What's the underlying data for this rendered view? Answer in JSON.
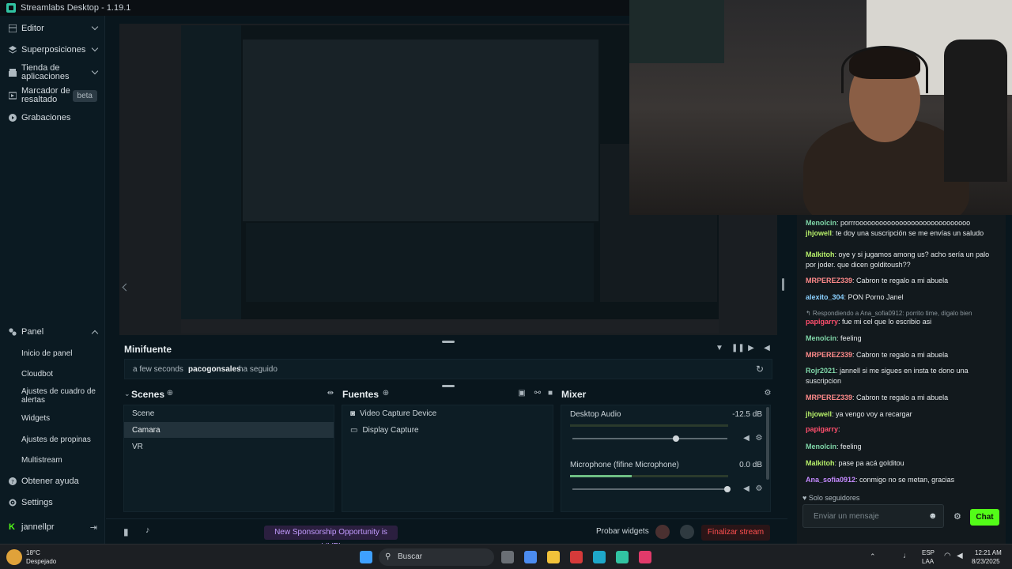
{
  "window": {
    "title": "Streamlabs Desktop - 1.19.1"
  },
  "sidebar": {
    "items": [
      {
        "label": "Editor"
      },
      {
        "label": "Superposiciones"
      },
      {
        "label": "Tienda de\naplicaciones"
      },
      {
        "label": "Marcador de\nresaltado",
        "badge": "beta"
      },
      {
        "label": "Grabaciones"
      }
    ],
    "panel": {
      "label": "Panel",
      "subitems": [
        "Inicio de panel",
        "Cloudbot",
        "Ajustes de cuadro de alertas",
        "Widgets",
        "Ajustes de propinas",
        "Multistream"
      ]
    },
    "help": "Obtener ayuda",
    "settings": "Settings",
    "user": "jannellpr"
  },
  "minifeed": {
    "title": "Minifuente",
    "event_time": "a few seconds",
    "event_user": "pacogonsales",
    "event_action": "ha seguido"
  },
  "scenes": {
    "title": "Scenes",
    "items": [
      "Scene",
      "Camara",
      "VR"
    ],
    "selected": "Camara"
  },
  "sources": {
    "title": "Fuentes",
    "items": [
      "Video Capture Device",
      "Display Capture"
    ]
  },
  "mixer": {
    "title": "Mixer",
    "channels": [
      {
        "name": "Desktop Audio",
        "db": "-12.5 dB",
        "level": 0.0,
        "volume": 0.67
      },
      {
        "name": "Microphone (fifine Microphone)",
        "db": "0.0 dB",
        "level": 0.39,
        "volume": 1.0
      }
    ]
  },
  "footer": {
    "sponsor": "New Sponsorship Opportunity is LIVE!",
    "widgets": "Probar widgets",
    "end_stream": "Finalizar stream"
  },
  "chat": {
    "messages": [
      {
        "user": "Menolcin",
        "color": "#7fd6a8",
        "text": "porrrooooooooooooooooooooooooooooo"
      },
      {
        "user": "jhjowell",
        "color": "#b7f06a",
        "text": "te doy una suscripción se me envías un saludo"
      },
      {
        "user": "Malkitoh",
        "color": "#b7f06a",
        "text": "oye y si jugamos among us? acho sería un palo por joder. que dicen golditoush??"
      },
      {
        "user": "MRPEREZ339",
        "color": "#ff8a8a",
        "text": "Cabron te regalo a mi abuela"
      },
      {
        "user": "alexito_304",
        "color": "#8ad0ff",
        "text": "PON Porno Janel"
      },
      {
        "reply": "Respondiendo a Ana_sofia0912: porrito time, dígalo bien"
      },
      {
        "user": "papigarry",
        "color": "#ff4f6d",
        "text": "fue mi cel que lo escribio asi"
      },
      {
        "user": "Menolcin",
        "color": "#7fd6a8",
        "text": "feeling"
      },
      {
        "user": "MRPEREZ339",
        "color": "#ff8a8a",
        "text": "Cabron te regalo a mi abuela"
      },
      {
        "user": "Rojr2021",
        "color": "#7fd6a8",
        "text": "jannell si me sigues en insta te dono una suscripcion"
      },
      {
        "user": "MRPEREZ339",
        "color": "#ff8a8a",
        "text": "Cabron te regalo a mi abuela"
      },
      {
        "user": "jhjowell",
        "color": "#b7f06a",
        "text": "ya vengo voy a recargar"
      },
      {
        "user": "papigarry",
        "color": "#ff4f6d",
        "text": ""
      },
      {
        "user": "Menolcin",
        "color": "#7fd6a8",
        "text": "feeling"
      },
      {
        "user": "Malkitoh",
        "color": "#b7f06a",
        "text": "pase pa acá golditou"
      },
      {
        "user": "Ana_sofia0912",
        "color": "#c58aff",
        "text": "conmigo no se metan, gracias"
      }
    ],
    "followers_only": "Solo seguidores",
    "input_placeholder": "Enviar un mensaje",
    "send": "Chat"
  },
  "taskbar": {
    "weather_temp": "18°C",
    "weather_desc": "Despejado",
    "search": "Buscar",
    "lang1": "ESP",
    "lang2": "LAA",
    "time": "12:21 AM",
    "date": "8/23/2025"
  }
}
